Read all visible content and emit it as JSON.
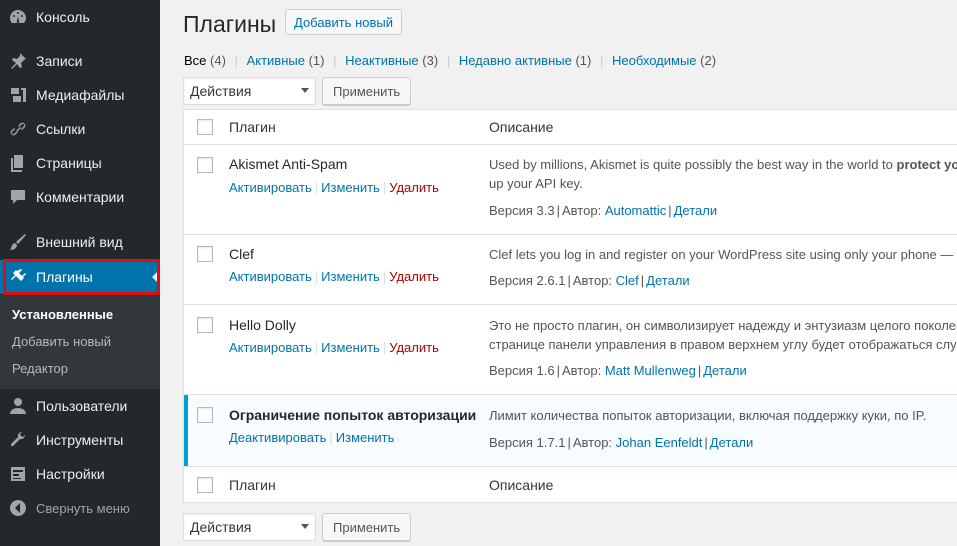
{
  "sidebar": {
    "items": [
      {
        "label": "Консоль",
        "icon": "dashboard-icon"
      },
      {
        "label": "Записи",
        "icon": "pin-icon"
      },
      {
        "label": "Медиафайлы",
        "icon": "media-icon"
      },
      {
        "label": "Ссылки",
        "icon": "link-icon"
      },
      {
        "label": "Страницы",
        "icon": "pages-icon"
      },
      {
        "label": "Комментарии",
        "icon": "comment-icon"
      },
      {
        "label": "Внешний вид",
        "icon": "brush-icon"
      },
      {
        "label": "Плагины",
        "icon": "plugin-icon"
      },
      {
        "label": "Пользователи",
        "icon": "user-icon"
      },
      {
        "label": "Инструменты",
        "icon": "wrench-icon"
      },
      {
        "label": "Настройки",
        "icon": "settings-icon"
      }
    ],
    "submenu": [
      "Установленные",
      "Добавить новый",
      "Редактор"
    ],
    "collapse_label": "Свернуть меню"
  },
  "header": {
    "title": "Плагины",
    "add_new": "Добавить новый"
  },
  "filters": [
    {
      "label": "Все",
      "count": "(4)"
    },
    {
      "label": "Активные",
      "count": "(1)"
    },
    {
      "label": "Неактивные",
      "count": "(3)"
    },
    {
      "label": "Недавно активные",
      "count": "(1)"
    },
    {
      "label": "Необходимые",
      "count": "(2)"
    }
  ],
  "bulk": {
    "select_value": "Действия",
    "apply_label": "Применить"
  },
  "table": {
    "col_plugin": "Плагин",
    "col_desc": "Описание",
    "rows": [
      {
        "name": "Akismet Anti-Spam",
        "act1": "Активировать",
        "act2": "Изменить",
        "act3": "Удалить",
        "desc_line1_plain": "Used by millions, Akismet is quite possibly the best way in the world to ",
        "desc_line1_bold": "protect yo",
        "desc_line2": "up your API key.",
        "version": "Версия 3.3",
        "author_label": "Автор:",
        "author": "Automattic",
        "details": "Детали"
      },
      {
        "name": "Clef",
        "act1": "Активировать",
        "act2": "Изменить",
        "act3": "Удалить",
        "desc_line1": "Clef lets you log in and register on your WordPress site using only your phone —",
        "version": "Версия 2.6.1",
        "author_label": "Автор:",
        "author": "Clef",
        "details": "Детали"
      },
      {
        "name": "Hello Dolly",
        "act1": "Активировать",
        "act2": "Изменить",
        "act3": "Удалить",
        "desc_line1": "Это не просто плагин, он символизирует надежду и энтузиазм целого поколен",
        "desc_line2": "странице панели управления в правом верхнем углу будет отображаться случ",
        "version": "Версия 1.6",
        "author_label": "Автор:",
        "author": "Matt Mullenweg",
        "details": "Детали"
      },
      {
        "name": "Ограничение попыток авторизации",
        "act1": "Деактивировать",
        "act2": "Изменить",
        "desc_line1": "Лимит количества попыток авторизации, включая поддержку куки, по IP.",
        "version": "Версия 1.7.1",
        "author_label": "Автор:",
        "author": "Johan Eenfeldt",
        "details": "Детали"
      }
    ]
  },
  "colors": {
    "sidebar_bg": "#23282d",
    "active_bg": "#0073aa",
    "link": "#0073aa",
    "delete": "#aa0000",
    "highlight_border": "#dc0d14",
    "active_row_border": "#00a0d2"
  }
}
